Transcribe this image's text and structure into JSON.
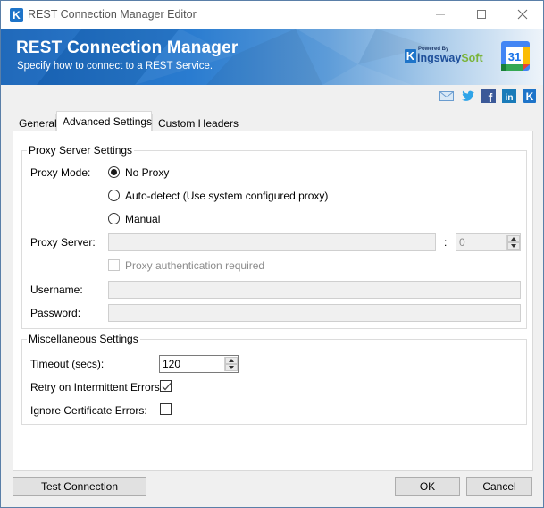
{
  "window": {
    "title": "REST Connection Manager Editor",
    "app_icon_glyph": "K",
    "controls": [
      "minimize",
      "maximize",
      "close"
    ]
  },
  "banner": {
    "title": "REST Connection Manager",
    "subtitle": "Specify how to connect to a REST Service.",
    "brand": {
      "k": "K",
      "powered_by": "Powered By",
      "name_part1": "ingsway",
      "name_part2": "Soft"
    },
    "service_icon": {
      "name": "google-calendar-icon",
      "label": "31"
    },
    "colors": {
      "dark": "#1763b8",
      "light": "#eef4fa"
    }
  },
  "social_icons": [
    {
      "name": "email-icon"
    },
    {
      "name": "twitter-icon"
    },
    {
      "name": "facebook-icon",
      "glyph": "f"
    },
    {
      "name": "linkedin-icon",
      "glyph": "in"
    },
    {
      "name": "kingswaysoft-icon",
      "glyph": "K"
    }
  ],
  "tabs": [
    {
      "label": "General",
      "active": false
    },
    {
      "label": "Advanced Settings",
      "active": true
    },
    {
      "label": "Custom Headers",
      "active": false
    }
  ],
  "proxy": {
    "group_label": "Proxy Server Settings",
    "mode_label": "Proxy Mode:",
    "modes": [
      {
        "label": "No Proxy",
        "checked": true
      },
      {
        "label": "Auto-detect (Use system configured proxy)",
        "checked": false
      },
      {
        "label": "Manual",
        "checked": false
      }
    ],
    "server_label": "Proxy Server:",
    "server_value": "",
    "port_separator": ":",
    "port_value": "0",
    "auth_label": "Proxy authentication required",
    "auth_checked": false,
    "username_label": "Username:",
    "username_value": "",
    "password_label": "Password:",
    "password_value": ""
  },
  "misc": {
    "group_label": "Miscellaneous Settings",
    "timeout_label": "Timeout (secs):",
    "timeout_value": "120",
    "retry_label": "Retry on Intermittent Errors:",
    "retry_checked": true,
    "ignore_cert_label": "Ignore Certificate Errors:",
    "ignore_cert_checked": false
  },
  "buttons": {
    "test_connection": "Test Connection",
    "ok": "OK",
    "cancel": "Cancel"
  }
}
